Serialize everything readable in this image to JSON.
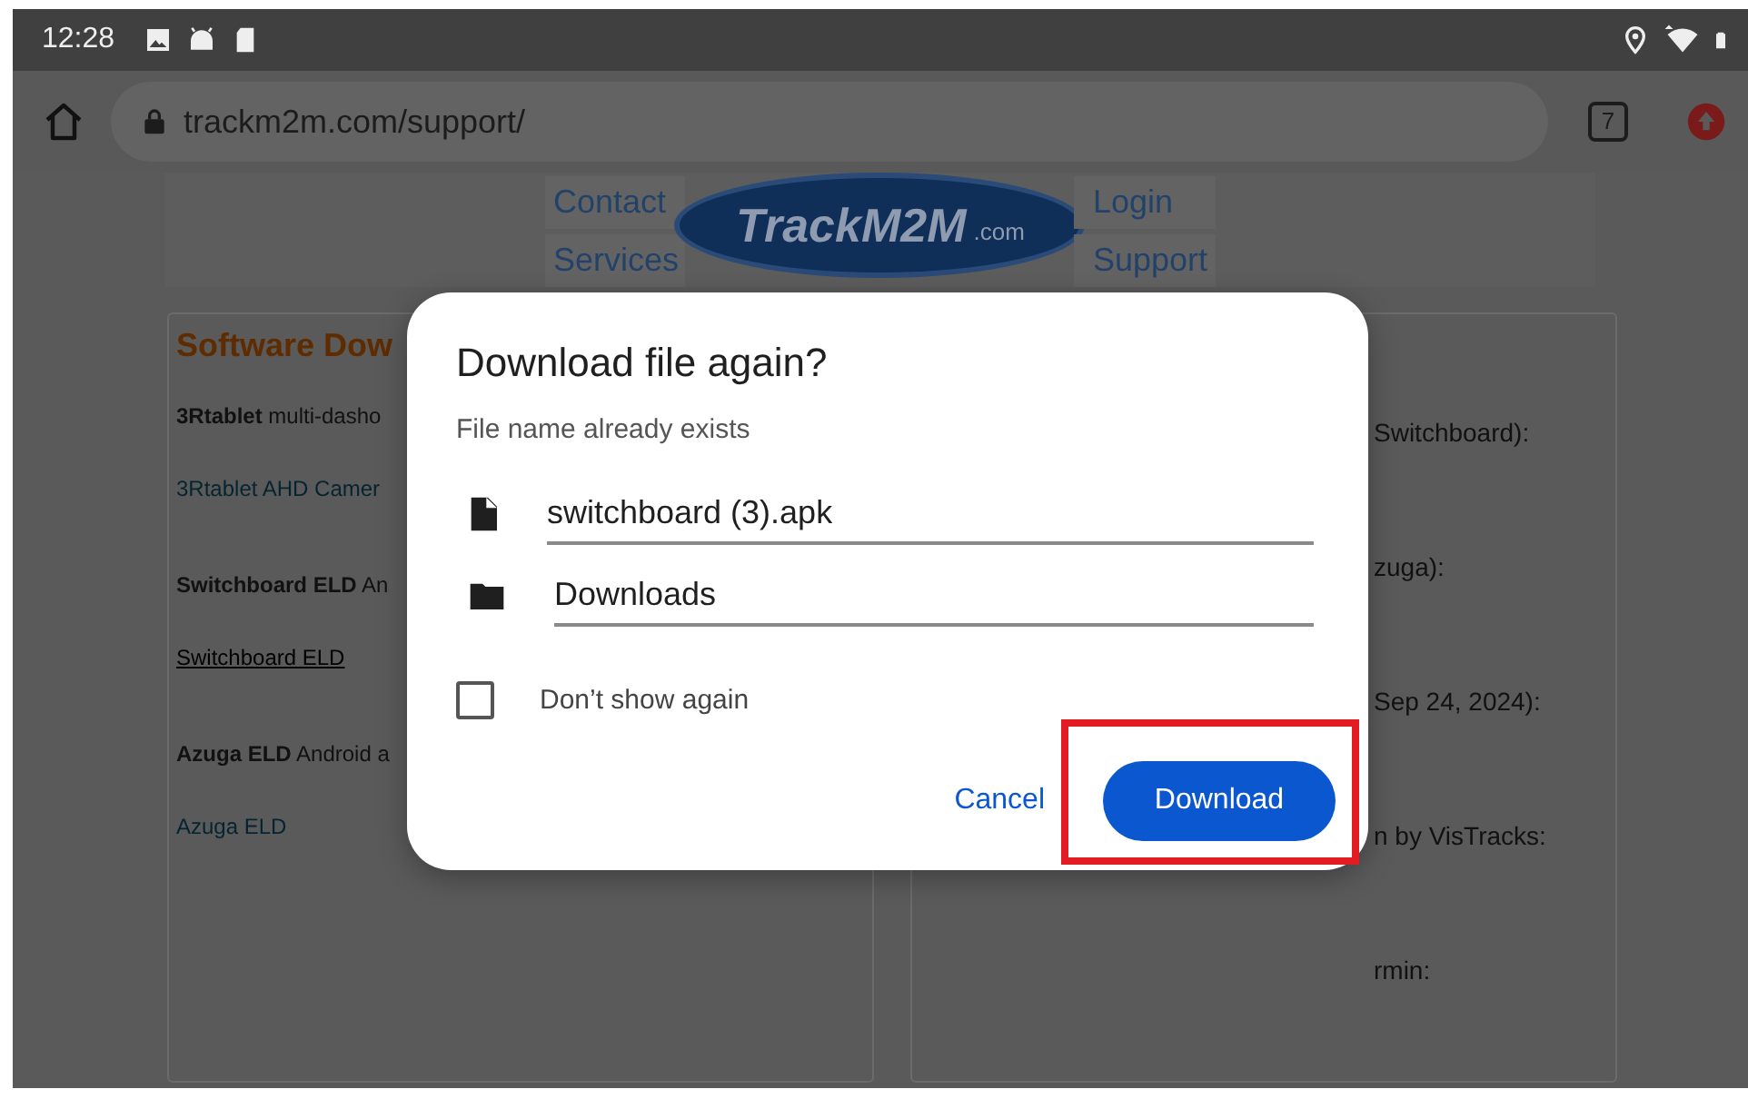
{
  "status_bar": {
    "time": "12:28"
  },
  "browser": {
    "url": "trackm2m.com/support/",
    "tab_count": "7"
  },
  "site_nav": {
    "left_links": [
      "Contact",
      "Services"
    ],
    "logo": {
      "name": "TrackM2M",
      "suffix": ".com"
    },
    "right_links": [
      "Login",
      "Support"
    ]
  },
  "left_panel": {
    "title": "Software Dow",
    "entries": [
      {
        "kind": "desc",
        "text": "**3Rtablet** multi-dasho"
      },
      {
        "kind": "link",
        "text": "3Rtablet AHD Camer",
        "underlined": false
      },
      {
        "kind": "desc",
        "text": "**Switchboard ELD** An"
      },
      {
        "kind": "link",
        "text": "Switchboard ELD",
        "underlined": true
      },
      {
        "kind": "desc",
        "text": "**Azuga ELD** Android a"
      },
      {
        "kind": "link",
        "text": "Azuga ELD",
        "underlined": false
      }
    ]
  },
  "right_panel": {
    "lines": [
      "Switchboard):",
      "zuga):",
      "Sep 24, 2024):",
      "n by VisTracks:",
      "rmin:"
    ]
  },
  "dialog": {
    "title": "Download file again?",
    "subtitle": "File name already exists",
    "fields": [
      {
        "kind": "file",
        "value": "switchboard (3).apk"
      },
      {
        "kind": "folder",
        "value": "Downloads"
      }
    ],
    "checkbox": {
      "label": "Don’t show again",
      "checked": false
    },
    "buttons": [
      {
        "kind": "text",
        "label": "Cancel",
        "highlighted": false
      },
      {
        "kind": "filled",
        "label": "Download",
        "highlighted": true
      }
    ]
  }
}
